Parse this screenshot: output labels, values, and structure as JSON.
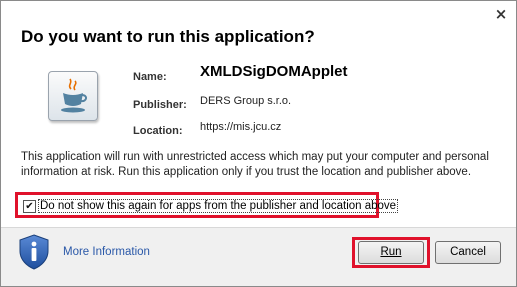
{
  "dialog": {
    "title": "Do you want to run this application?",
    "close_glyph": "×",
    "app_icon": "java-coffee-cup-icon"
  },
  "details": {
    "name_label": "Name:",
    "name_value": "XMLDSigDOMApplet",
    "publisher_label": "Publisher:",
    "publisher_value": "DERS Group s.r.o.",
    "location_label": "Location:",
    "location_value": "https://mis.jcu.cz"
  },
  "warning_text": "This application will run with unrestricted access which may put your computer and personal information at risk. Run this application only if you trust the location and publisher above.",
  "checkbox": {
    "checked": true,
    "label": "Do not show this again for apps from the publisher and location above"
  },
  "footer": {
    "shield_icon": "info-shield-icon",
    "more_info_label": "More Information",
    "run_label": "Run",
    "cancel_label": "Cancel"
  },
  "colors": {
    "highlight": "#e0112b",
    "link": "#2a58a8",
    "shield": "#2f63b8"
  }
}
